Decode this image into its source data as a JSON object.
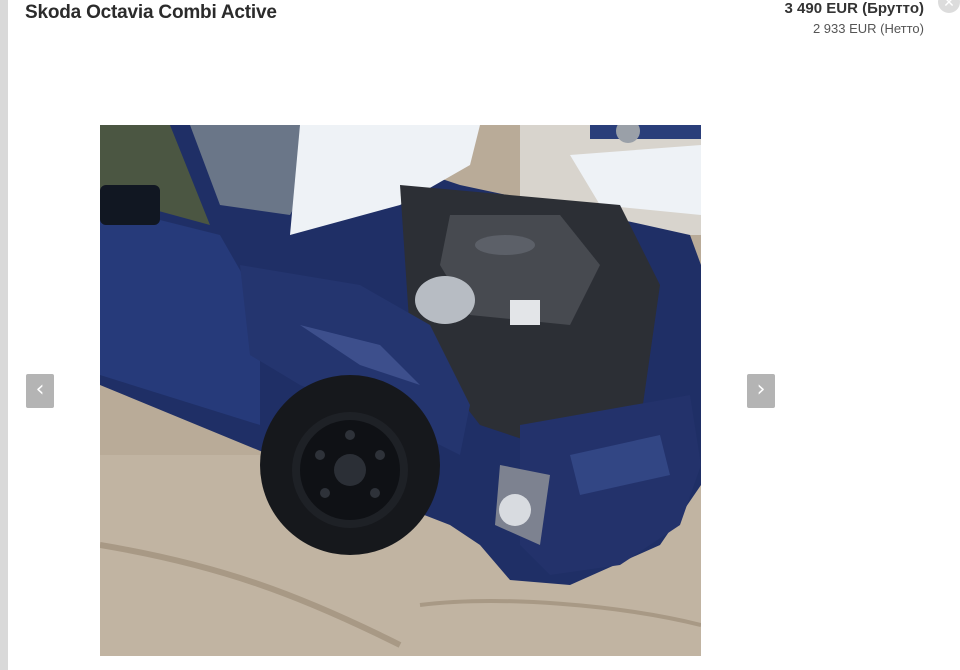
{
  "listing": {
    "title": "Skoda Octavia Combi Active",
    "price_gross": "3 490 EUR (Брутто)",
    "price_net": "2 933 EUR (Нетто)"
  },
  "controls": {
    "close_glyph": "✕",
    "prev_glyph": "‹",
    "next_glyph": "›"
  },
  "icons": {
    "close": "close-icon",
    "prev": "chevron-left-icon",
    "next": "chevron-right-icon"
  },
  "colors": {
    "car_body": "#1f2f66",
    "ground": "#b9ab98",
    "snow": "#eef2f6",
    "arrow_bg": "#b4b4b4",
    "title_text": "#2b2b2b"
  }
}
